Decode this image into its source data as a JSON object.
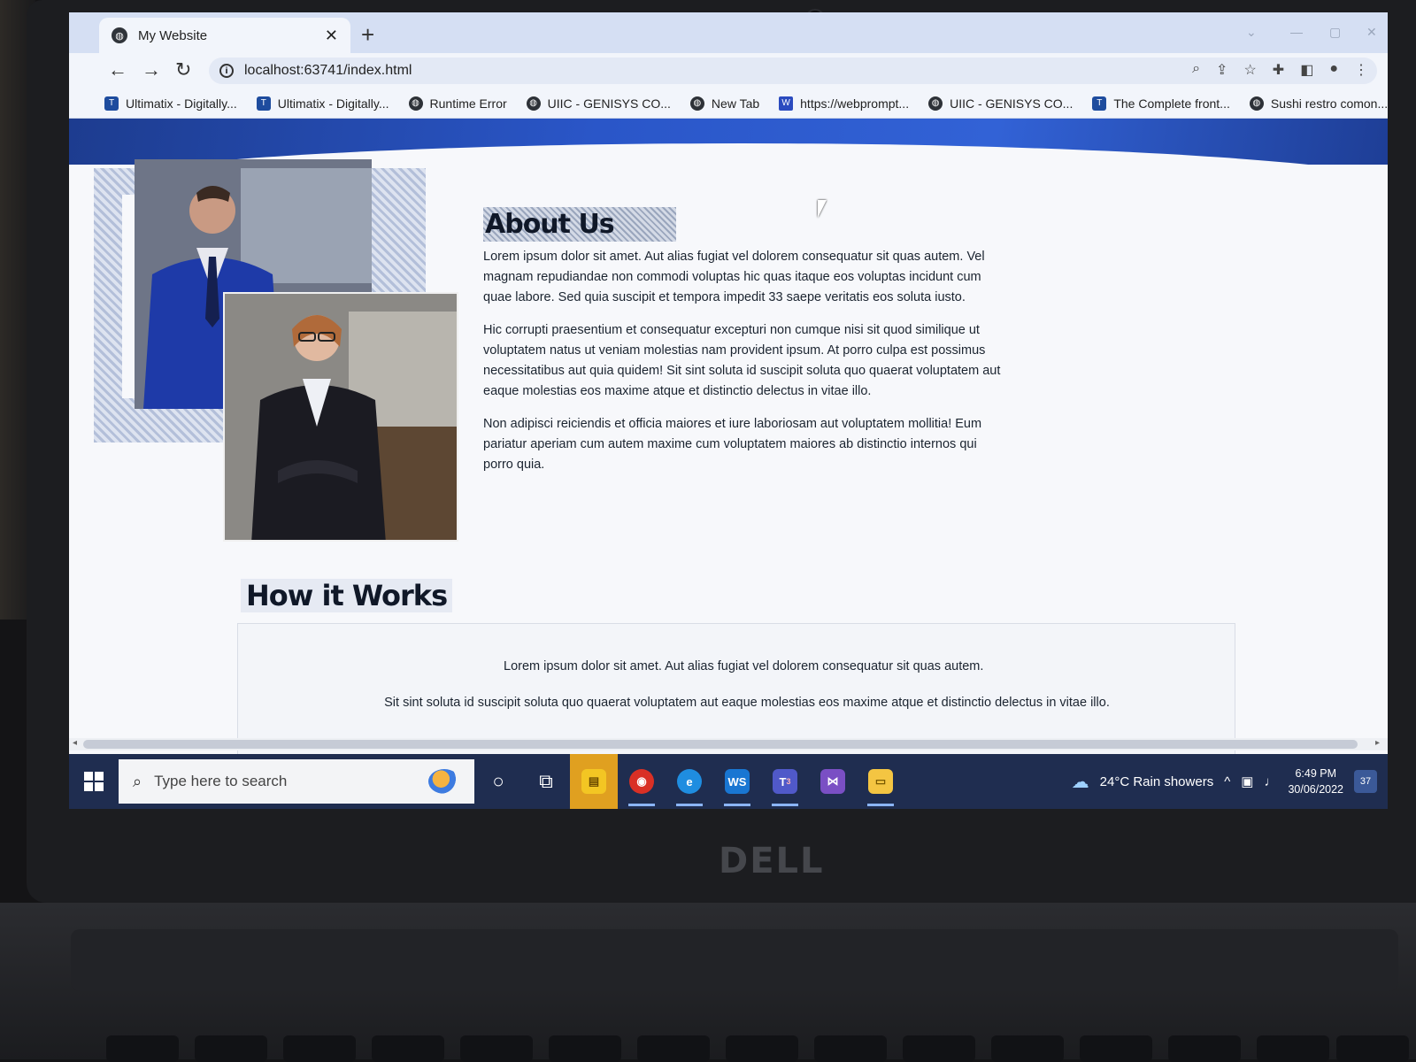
{
  "browser": {
    "tab_title": "My Website",
    "tab_close": "✕",
    "new_tab": "+",
    "url": "localhost:63741/index.html"
  },
  "bookmarks": [
    {
      "label": "Ultimatix - Digitally...",
      "icon": "tcs-icon"
    },
    {
      "label": "Ultimatix - Digitally...",
      "icon": "tcs-icon"
    },
    {
      "label": "Runtime Error",
      "icon": "globe-icon"
    },
    {
      "label": "UIIC - GENISYS CO...",
      "icon": "globe-icon"
    },
    {
      "label": "New Tab",
      "icon": "globe-icon"
    },
    {
      "label": "https://webprompt...",
      "icon": "w-icon"
    },
    {
      "label": "UIIC - GENISYS CO...",
      "icon": "globe-icon"
    },
    {
      "label": "The Complete front...",
      "icon": "tcs-icon"
    },
    {
      "label": "Sushi restro comon...",
      "icon": "globe-icon"
    }
  ],
  "page": {
    "about_title": "About Us",
    "about_paragraphs": [
      "Lorem ipsum dolor sit amet. Aut alias fugiat vel dolorem consequatur sit quas autem. Vel magnam repudiandae non commodi voluptas hic quas itaque eos voluptas incidunt cum quae labore. Sed quia suscipit et tempora impedit 33 saepe veritatis eos soluta iusto.",
      "Hic corrupti praesentium et consequatur excepturi non cumque nisi sit quod similique ut voluptatem natus ut veniam molestias nam provident ipsum. At porro culpa est possimus necessitatibus aut quia quidem! Sit sint soluta id suscipit soluta quo quaerat voluptatem aut eaque molestias eos maxime atque et distinctio delectus in vitae illo.",
      "Non adipisci reiciendis et officia maiores et iure laboriosam aut voluptatem mollitia! Eum pariatur aperiam cum autem maxime cum voluptatem maiores ab distinctio internos qui porro quia."
    ],
    "how_title": "How it Works",
    "how_line1": "Lorem ipsum dolor sit amet. Aut alias fugiat vel dolorem consequatur sit quas autem.",
    "how_line2": "Sit sint soluta id suscipit soluta quo quaerat voluptatem aut eaque molestias eos maxime atque et distinctio delectus in vitae illo."
  },
  "taskbar": {
    "search_placeholder": "Type here to search",
    "weather": "24°C  Rain showers",
    "time": "6:49 PM",
    "date": "30/06/2022",
    "notification_count": "37",
    "teams_badge": "3"
  },
  "device": {
    "brand": "DELL"
  },
  "colors": {
    "banner": "#2a56c8",
    "taskbar": "#1f2d50",
    "tab_strip": "#d5dff3"
  }
}
